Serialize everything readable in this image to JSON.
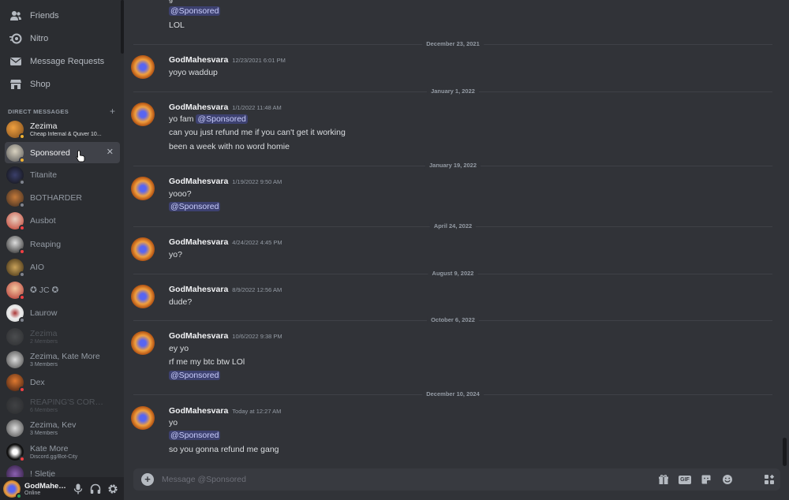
{
  "colors": {
    "sidebar_bg": "#2b2d31",
    "chat_bg": "#313338",
    "mention_text": "#c9cdfb",
    "online": "#23a55a",
    "dnd": "#f23f43",
    "idle": "#f0b232",
    "offline": "#80848e"
  },
  "nav": {
    "friends": {
      "label": "Friends",
      "icon": "friends-icon"
    },
    "nitro": {
      "label": "Nitro",
      "icon": "nitro-icon"
    },
    "message_requests": {
      "label": "Message Requests",
      "icon": "envelope-icon"
    },
    "shop": {
      "label": "Shop",
      "icon": "shop-icon"
    }
  },
  "dm_section": {
    "title": "DIRECT MESSAGES",
    "add_icon": "plus-icon"
  },
  "dms": [
    {
      "name": "Zezima",
      "sub": "Cheap Infernal & Quiver 10...",
      "status": "idle"
    },
    {
      "name": "Sponsored",
      "sub": "",
      "status": "idle",
      "close_icon": "close-icon"
    },
    {
      "name": "Titanite",
      "sub": "",
      "status": "offline"
    },
    {
      "name": "BOTHARDER",
      "sub": "",
      "status": "offline"
    },
    {
      "name": "Ausbot",
      "sub": "",
      "status": "dnd"
    },
    {
      "name": "Reaping",
      "sub": "",
      "status": "dnd"
    },
    {
      "name": "AIO",
      "sub": "",
      "status": "offline"
    },
    {
      "name": "✪ JC ✪",
      "sub": "",
      "status": "dnd"
    },
    {
      "name": "Laurow",
      "sub": "",
      "status": "offline"
    },
    {
      "name": "Zezima",
      "sub": "2 Members",
      "status": ""
    },
    {
      "name": "Zezima, Kate More",
      "sub": "3 Members",
      "status": ""
    },
    {
      "name": "Dex",
      "sub": "",
      "status": "dnd"
    },
    {
      "name": "REAPING'S CORNER ...",
      "sub": "6 Members",
      "status": ""
    },
    {
      "name": "Zezima, Kev",
      "sub": "3 Members",
      "status": ""
    },
    {
      "name": "Kate More",
      "sub": "Discord.gg/Bot-City",
      "status": "dnd"
    },
    {
      "name": "! Sletje",
      "sub": "",
      "status": ""
    }
  ],
  "user_panel": {
    "name": "GodMahes...",
    "status_text": "Online",
    "mic_icon": "microphone-icon",
    "headphones_icon": "headphones-icon",
    "settings_icon": "gear-icon"
  },
  "chat": {
    "top_fragment": {
      "mention": "@Sponsored",
      "text": "LOL"
    },
    "groups": [
      {
        "date": "December 23, 2021",
        "author": "GodMahesvara",
        "time": "12/23/2021 6:01 PM",
        "lines": [
          {
            "text": "yoyo waddup"
          }
        ]
      },
      {
        "date": "January 1, 2022",
        "author": "GodMahesvara",
        "time": "1/1/2022 11:48 AM",
        "lines": [
          {
            "text": "yo fam ",
            "mention": "@Sponsored"
          },
          {
            "text": "can you just refund me if you can't get it working"
          },
          {
            "text": "been a week with no word homie"
          }
        ]
      },
      {
        "date": "January 19, 2022",
        "author": "GodMahesvara",
        "time": "1/19/2022 9:50 AM",
        "lines": [
          {
            "text": "yooo?"
          },
          {
            "text": "",
            "mention": "@Sponsored"
          }
        ]
      },
      {
        "date": "April 24, 2022",
        "author": "GodMahesvara",
        "time": "4/24/2022 4:45 PM",
        "lines": [
          {
            "text": "yo?"
          }
        ]
      },
      {
        "date": "August 9, 2022",
        "author": "GodMahesvara",
        "time": "8/9/2022 12:56 AM",
        "lines": [
          {
            "text": "dude?"
          }
        ]
      },
      {
        "date": "October 6, 2022",
        "author": "GodMahesvara",
        "time": "10/6/2022 9:38 PM",
        "lines": [
          {
            "text": "ey yo"
          },
          {
            "text": "rf me my btc btw LOl"
          },
          {
            "text": "",
            "mention": "@Sponsored"
          }
        ]
      },
      {
        "date": "December 10, 2024",
        "author": "GodMahesvara",
        "time": "Today at 12:27 AM",
        "lines": [
          {
            "text": "yo"
          },
          {
            "text": "",
            "mention": "@Sponsored"
          },
          {
            "text": "so you gonna refund me gang"
          }
        ]
      }
    ]
  },
  "composer": {
    "placeholder": "Message @Sponsored",
    "add_icon": "plus-circle-icon",
    "tools": [
      "gift-icon",
      "gif-icon",
      "sticker-icon",
      "emoji-icon"
    ],
    "gif_label": "GIF",
    "apps_icon": "apps-icon"
  }
}
